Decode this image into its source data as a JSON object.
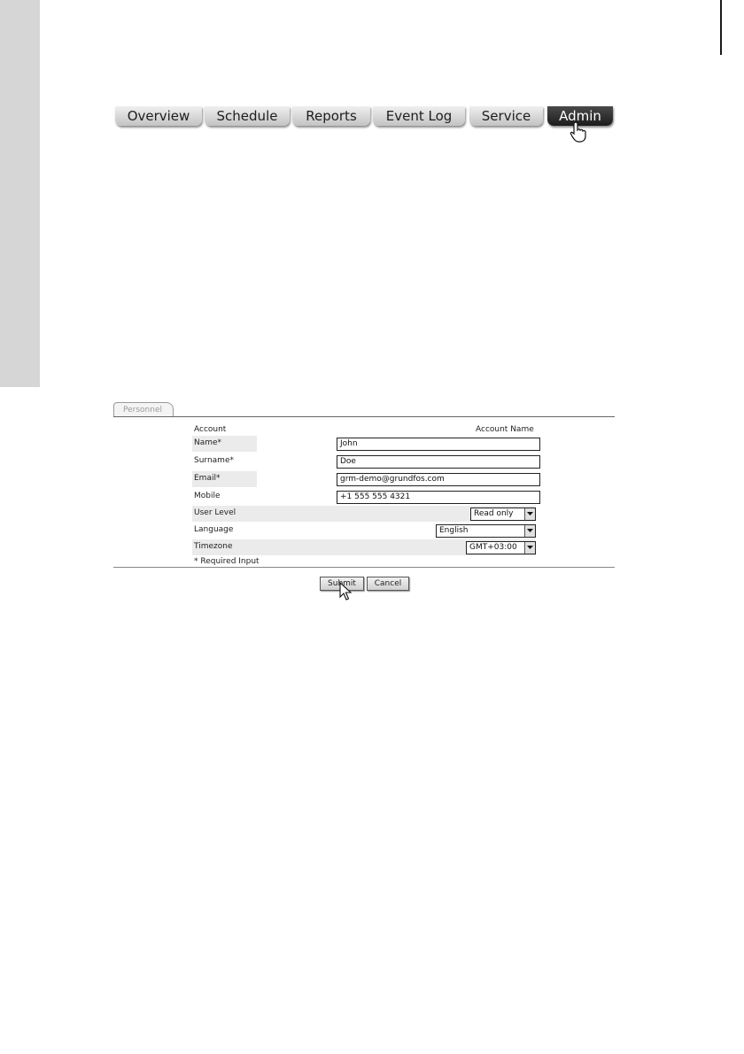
{
  "nav": {
    "tabs": [
      {
        "label": "Overview"
      },
      {
        "label": "Schedule"
      },
      {
        "label": "Reports"
      },
      {
        "label": "Event Log"
      },
      {
        "label": "Service"
      },
      {
        "label": "Admin",
        "active": true
      }
    ]
  },
  "form": {
    "tab_label": "Personnel",
    "header_left": "Account",
    "header_right": "Account Name",
    "fields": {
      "name": {
        "label": "Name*",
        "value": "John"
      },
      "surname": {
        "label": "Surname*",
        "value": "Doe"
      },
      "email": {
        "label": "Email*",
        "value": "grm-demo@grundfos.com"
      },
      "mobile": {
        "label": "Mobile",
        "value": "+1 555 555 4321"
      },
      "user_level": {
        "label": "User Level",
        "value": "Read only"
      },
      "language": {
        "label": "Language",
        "value": "English"
      },
      "timezone": {
        "label": "Timezone",
        "value": "GMT+03:00"
      }
    },
    "required_note": "* Required Input",
    "submit_label": "Submit",
    "cancel_label": "Cancel"
  },
  "colors": {
    "active_tab": "#1c1c1c",
    "inactive_tab": "#c3c3c3",
    "side_strip": "#d6d6d6"
  },
  "icons": [
    "chevron-down-icon",
    "hand-pointer-icon",
    "arrow-pointer-icon"
  ]
}
